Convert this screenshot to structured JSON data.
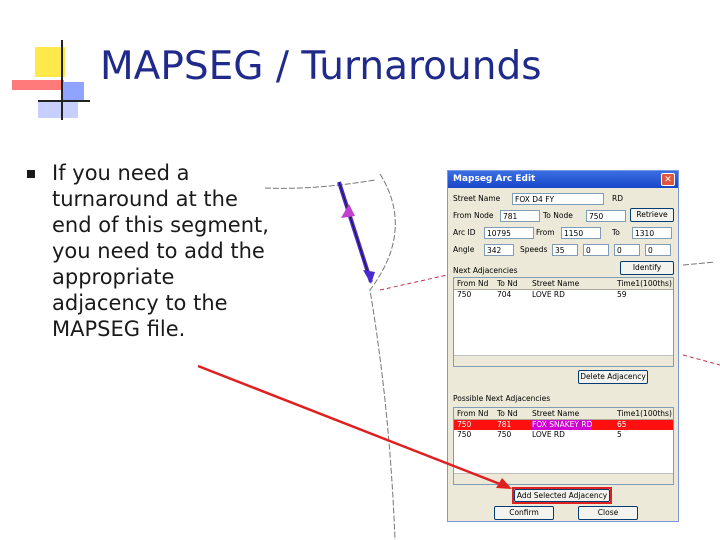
{
  "slide": {
    "title": "MAPSEG / Turnarounds",
    "bullet": "If you need a turnaround at the end of this segment, you need to add the appropriate adjacency to the MAPSEG file."
  },
  "dialog": {
    "title": "Mapseg Arc Edit",
    "close_glyph": "✕",
    "street_name_label": "Street Name",
    "street_name_value": "FOX D4 FY",
    "street_suffix": "RD",
    "from_node_label": "From Node",
    "from_node_value": "781",
    "to_node_label": "To Node",
    "to_node_value": "750",
    "retrieve_label": "Retrieve",
    "arc_id_label": "Arc ID",
    "arc_id_value": "10795",
    "from_label": "From",
    "from_value": "1150",
    "to_label": "To",
    "to_value": "1310",
    "angle_label": "Angle",
    "angle_value": "342",
    "speeds_label": "Speeds",
    "speed1": "35",
    "speed2": "0",
    "speed3": "0",
    "speed4": "0",
    "next_adj_label": "Next Adjacencies",
    "identify_label": "Identify",
    "delete_adj_label": "Delete Adjacency",
    "possible_adj_label": "Possible Next Adjacencies",
    "add_selected_label": "Add Selected Adjacency",
    "confirm_label": "Confirm",
    "close_label": "Close",
    "columns": [
      "From Nd",
      "To Nd",
      "Street Name",
      "Time1(100ths)"
    ],
    "next_rows": [
      [
        "750",
        "704",
        "LOVE RD",
        "59"
      ]
    ],
    "possible_rows": [
      [
        "750",
        "781",
        "FOX SNAKEY RD",
        "65"
      ],
      [
        "750",
        "750",
        "LOVE RD",
        "5"
      ]
    ]
  },
  "colors": {
    "title": "#1f2a8a",
    "arrow": "#e02020",
    "segment": "#4a2ad0",
    "selection": "#ff1010"
  }
}
